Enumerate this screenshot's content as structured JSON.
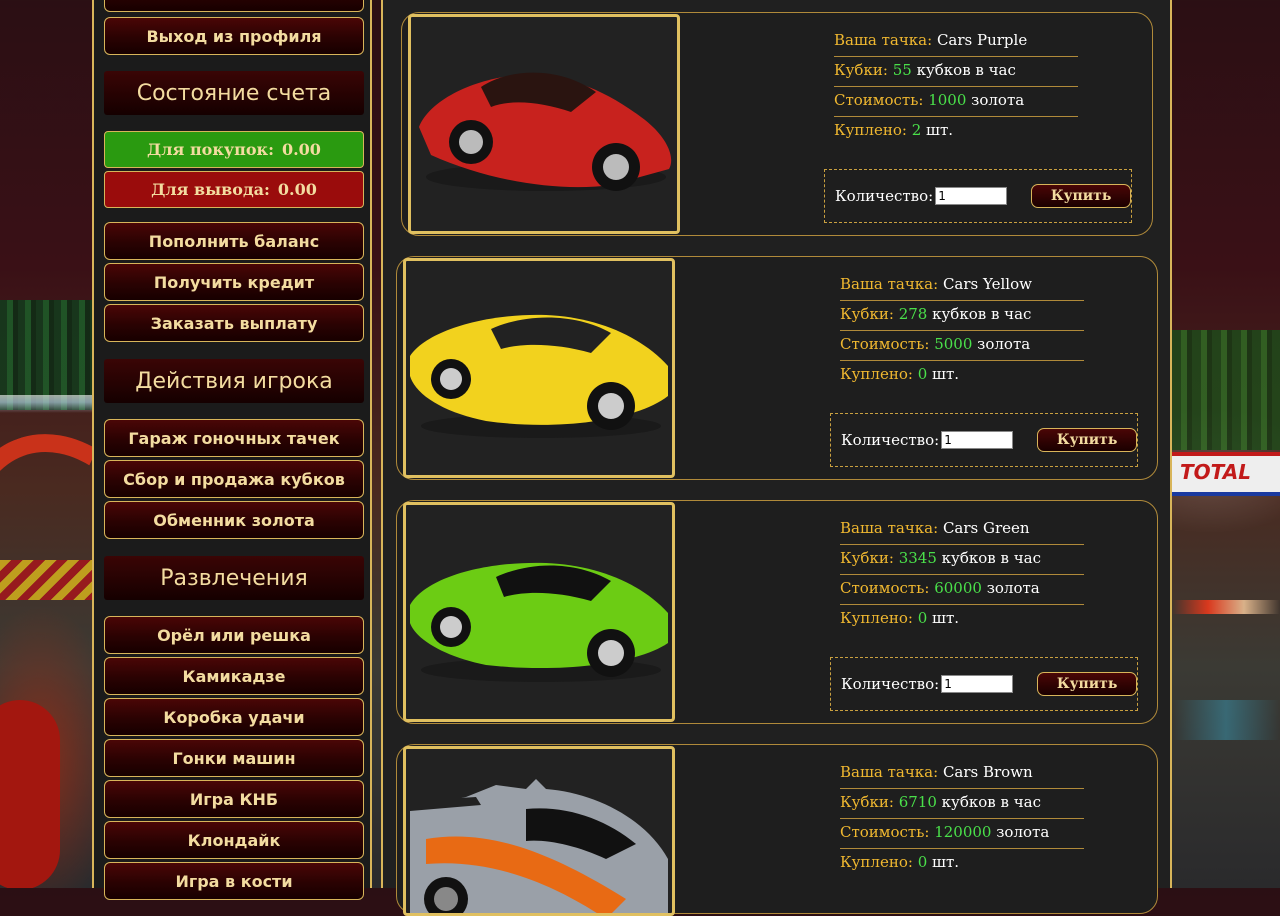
{
  "sidebar": {
    "top_buttons": [
      {
        "label": "Выход из профиля"
      }
    ],
    "account": {
      "heading": "Состояние счета",
      "buy_label": "Для покупок:",
      "buy_value": "0.00",
      "withdraw_label": "Для вывода:",
      "withdraw_value": "0.00",
      "green": "#2a9a10",
      "red": "#9a0c0c"
    },
    "account_buttons": [
      {
        "label": "Пополнить баланс"
      },
      {
        "label": "Получить кредит"
      },
      {
        "label": "Заказать выплату"
      }
    ],
    "actions": {
      "heading": "Действия игрока",
      "items": [
        {
          "label": "Гараж гоночных тачек"
        },
        {
          "label": "Сбор и продажа кубков"
        },
        {
          "label": "Обменник золота"
        }
      ]
    },
    "fun": {
      "heading": "Развлечения",
      "items": [
        {
          "label": "Орёл или решка"
        },
        {
          "label": "Камикадзе"
        },
        {
          "label": "Коробка удачи"
        },
        {
          "label": "Гонки машин"
        },
        {
          "label": "Игра КНБ"
        },
        {
          "label": "Клондайк"
        },
        {
          "label": "Игра в кости"
        }
      ]
    }
  },
  "labels": {
    "car": "Ваша тачка:",
    "cups": "Кубки:",
    "cups_unit": "кубков в час",
    "cost": "Стоимость:",
    "cost_unit": "золота",
    "bought": "Куплено:",
    "bought_unit": "шт.",
    "quantity": "Количество:",
    "buy": "Купить"
  },
  "cars": [
    {
      "name": "Cars Purple",
      "cups": "55",
      "cost": "1000",
      "bought": "2",
      "qty": "1",
      "color": "#c8221e"
    },
    {
      "name": "Cars Yellow",
      "cups": "278",
      "cost": "5000",
      "bought": "0",
      "qty": "1",
      "color": "#f2d21e"
    },
    {
      "name": "Cars Green",
      "cups": "3345",
      "cost": "60000",
      "bought": "0",
      "qty": "1",
      "color": "#6ccc14"
    },
    {
      "name": "Cars Brown",
      "cups": "6710",
      "cost": "120000",
      "bought": "0",
      "qty": "1",
      "color": "#9aa0a8"
    }
  ],
  "background": {
    "banner_text": "TOTAL"
  }
}
